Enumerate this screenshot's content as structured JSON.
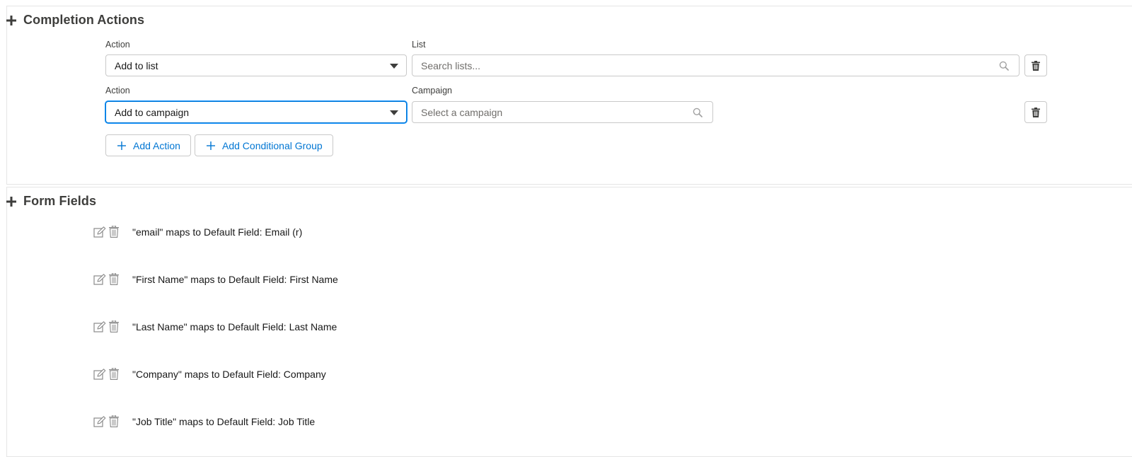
{
  "completion_actions": {
    "title": "Completion Actions",
    "rows": [
      {
        "action_label": "Action",
        "action_value": "Add to list",
        "target_label": "List",
        "target_placeholder": "Search lists..."
      },
      {
        "action_label": "Action",
        "action_value": "Add to campaign",
        "target_label": "Campaign",
        "target_placeholder": "Select a campaign"
      }
    ],
    "add_action_label": "Add Action",
    "add_group_label": "Add Conditional Group"
  },
  "form_fields": {
    "title": "Form Fields",
    "items": [
      "\"email\" maps to Default Field: Email (r)",
      "\"First Name\" maps to Default Field: First Name",
      "\"Last Name\" maps to Default Field: Last Name",
      "\"Company\" maps to Default Field: Company",
      "\"Job Title\" maps to Default Field: Job Title"
    ]
  },
  "colors": {
    "brand_blue": "#0176d3",
    "border": "#c9c9c9",
    "text": "#181818",
    "label": "#3e3e3c"
  },
  "icons": [
    "plus-icon",
    "chevron-down-icon",
    "search-icon",
    "trash-icon",
    "edit-icon"
  ]
}
